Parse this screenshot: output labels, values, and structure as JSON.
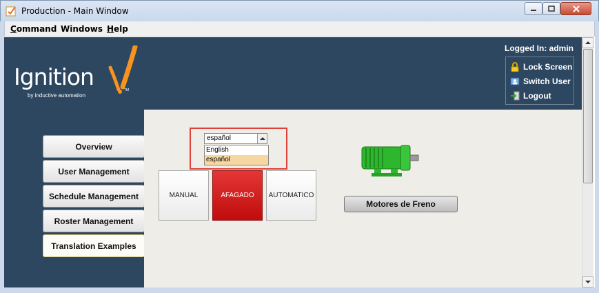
{
  "window": {
    "title": "Production - Main Window"
  },
  "menu": [
    {
      "label": "Command",
      "mnemonic": "C"
    },
    {
      "label": "Windows",
      "mnemonic": ""
    },
    {
      "label": "Help",
      "mnemonic": "H"
    }
  ],
  "logo": {
    "word": "Ignition",
    "tagline": "by inductive automation",
    "tm": "TM"
  },
  "user": {
    "logged_in": "Logged In: admin",
    "actions": [
      {
        "label": "Lock Screen",
        "icon": "lock-icon"
      },
      {
        "label": "Switch User",
        "icon": "switch-user-icon"
      },
      {
        "label": "Logout",
        "icon": "logout-icon"
      }
    ]
  },
  "nav": [
    {
      "label": "Overview"
    },
    {
      "label": "User Management"
    },
    {
      "label": "Schedule Management"
    },
    {
      "label": "Roster Management"
    },
    {
      "label": "Translation Examples"
    }
  ],
  "language": {
    "selected": "español",
    "options": [
      "English",
      "español"
    ]
  },
  "modes": {
    "manual": "MANUAL",
    "afagado": "AFAGADO",
    "automatico": "AUTOMATICO"
  },
  "motor": {
    "label": "Motores de Freno"
  },
  "colors": {
    "accent": "#2d4760",
    "active_mode": "#d41c1c",
    "highlight_border": "#e0403a",
    "motor": "#2fb62f"
  }
}
